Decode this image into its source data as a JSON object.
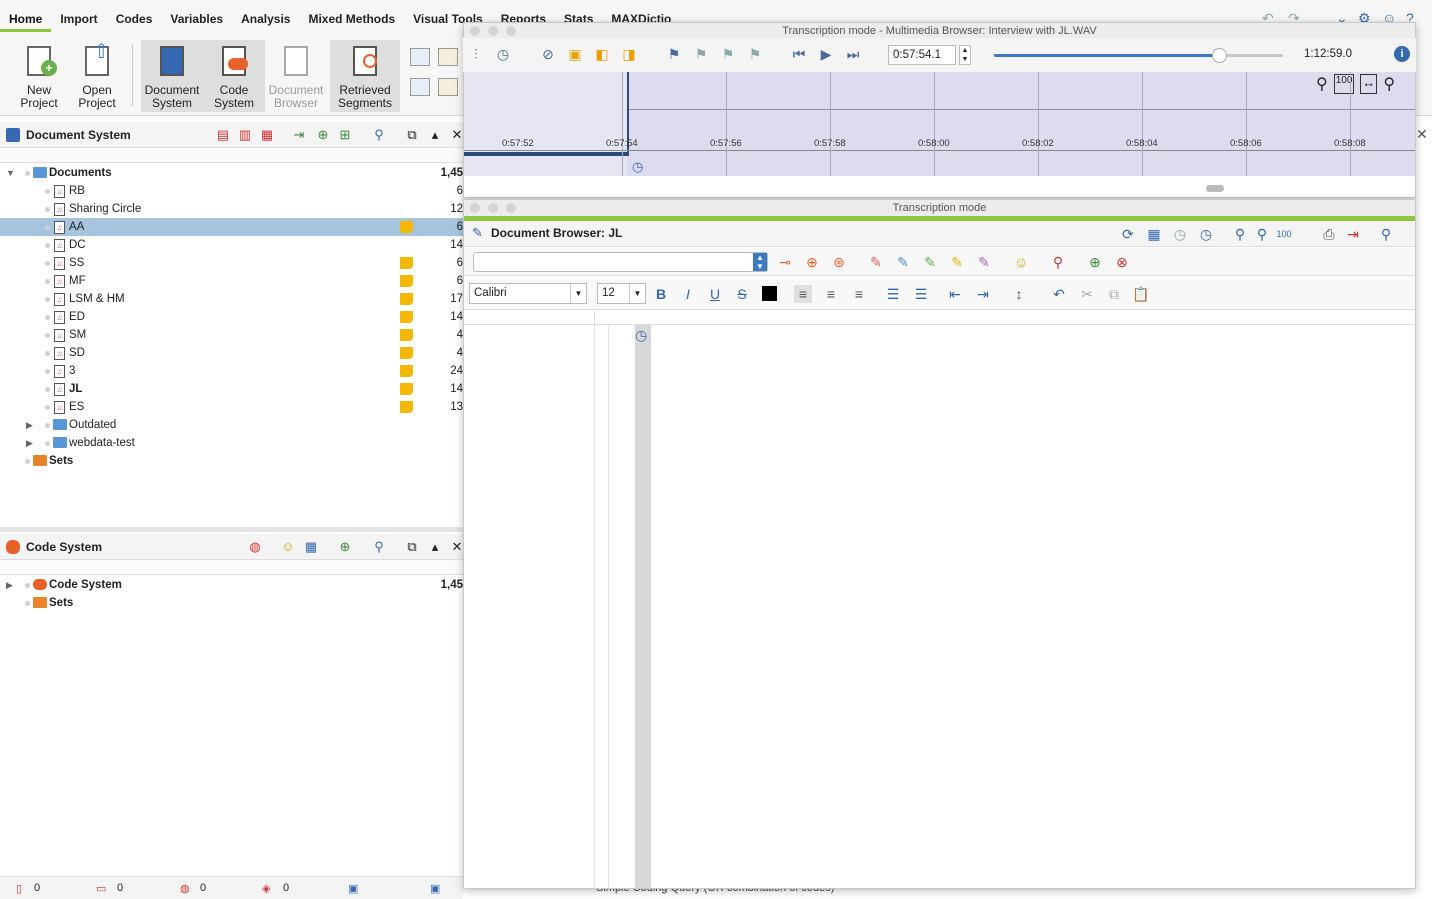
{
  "ribbon": {
    "tabs": [
      "Home",
      "Import",
      "Codes",
      "Variables",
      "Analysis",
      "Mixed Methods",
      "Visual Tools",
      "Reports",
      "Stats",
      "MAXDictio"
    ],
    "buttons": {
      "new_project": "New\nProject",
      "open_project": "Open\nProject",
      "document_system": "Document\nSystem",
      "code_system": "Code\nSystem",
      "document_browser": "Document\nBrowser",
      "retrieved_segments": "Retrieved\nSegments"
    }
  },
  "document_system": {
    "title": "Document System",
    "root": {
      "label": "Documents",
      "count": "1,45"
    },
    "docs": [
      {
        "label": "RB",
        "count": "6",
        "memo": false
      },
      {
        "label": "Sharing Circle",
        "count": "12",
        "memo": false
      },
      {
        "label": "AA",
        "count": "6",
        "memo": true
      },
      {
        "label": "DC",
        "count": "14",
        "memo": false
      },
      {
        "label": "SS",
        "count": "6",
        "memo": true
      },
      {
        "label": "MF",
        "count": "6",
        "memo": true
      },
      {
        "label": "LSM & HM",
        "count": "17",
        "memo": true
      },
      {
        "label": "ED",
        "count": "14",
        "memo": true
      },
      {
        "label": "SM",
        "count": "4",
        "memo": true
      },
      {
        "label": "SD",
        "count": "4",
        "memo": true
      },
      {
        "label": "3",
        "count": "24",
        "memo": true
      },
      {
        "label": "JL",
        "count": "14",
        "memo": true
      },
      {
        "label": "ES",
        "count": "13",
        "memo": true
      }
    ],
    "folders": [
      "Outdated",
      "webdata-test"
    ],
    "sets": "Sets"
  },
  "code_system": {
    "title": "Code System",
    "root": {
      "label": "Code System",
      "count": "1,45"
    },
    "sets": "Sets"
  },
  "status_bar": {
    "docs": "0",
    "codes": "0",
    "memos": "0",
    "segments": "0",
    "hidden_text": "Simple Coding Query (OR combination of codes)"
  },
  "multimedia": {
    "title": "Transcription mode - Multimedia Browser:  Interview with JL.WAV",
    "position": "0:57:54.1",
    "duration": "1:12:59.0",
    "slider_fraction": 0.78,
    "ticks": [
      "0:57:52",
      "0:57:54",
      "0:57:56",
      "0:57:58",
      "0:58:00",
      "0:58:02",
      "0:58:04",
      "0:58:06",
      "0:58:08"
    ]
  },
  "transcription": {
    "title": "Transcription mode",
    "browser_title": "Document Browser: JL",
    "font": "Calibri",
    "font_size": "12"
  }
}
